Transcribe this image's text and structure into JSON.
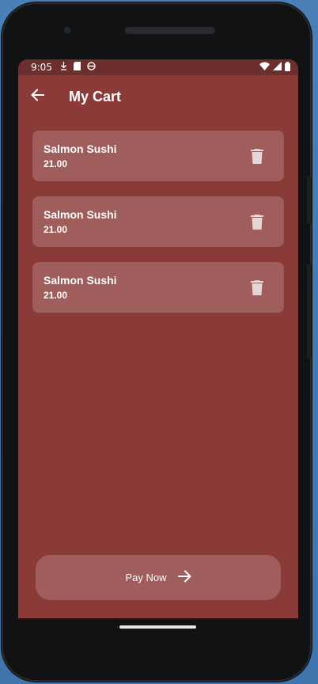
{
  "status_bar": {
    "time": "9:05",
    "icons_left": [
      "download-icon",
      "sd-card-icon",
      "sync-icon"
    ],
    "icons_right": [
      "wifi-icon",
      "signal-icon",
      "battery-icon"
    ]
  },
  "app_bar": {
    "title": "My Cart",
    "back_icon": "arrow-left-icon"
  },
  "cart": {
    "items": [
      {
        "name": "Salmon Sushi",
        "price": "21.00"
      },
      {
        "name": "Salmon Sushi",
        "price": "21.00"
      },
      {
        "name": "Salmon Sushi",
        "price": "21.00"
      }
    ],
    "delete_icon": "trash-icon"
  },
  "checkout": {
    "label": "Pay Now",
    "icon": "arrow-right-icon"
  },
  "colors": {
    "background": "#8a3a37",
    "status_bar": "#6d2f2d",
    "card": "rgba(255,255,255,0.18)",
    "text": "#ffffff"
  }
}
